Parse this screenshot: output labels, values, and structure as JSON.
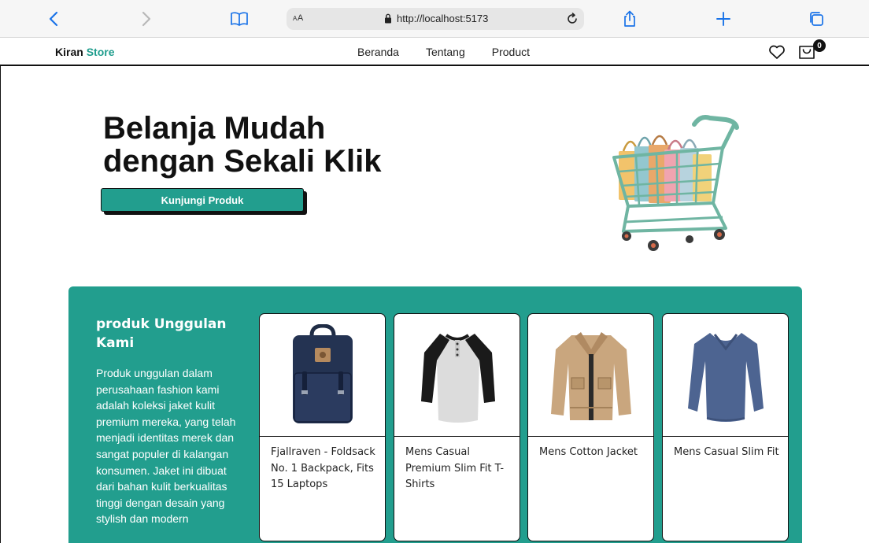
{
  "browser": {
    "text_size_label": "AA",
    "url": "http://localhost:5173"
  },
  "nav": {
    "brand_primary": "Kiran",
    "brand_accent": "Store",
    "links": [
      "Beranda",
      "Tentang",
      "Product"
    ],
    "cart_count": "0"
  },
  "hero": {
    "title_line1": "Belanja Mudah",
    "title_line2": "dengan Sekali Klik",
    "cta_label": "Kunjungi Produk"
  },
  "featured": {
    "title": "produk Unggulan Kami",
    "description": "Produk unggulan dalam perusahaan fashion kami adalah koleksi jaket kulit premium mereka, yang telah menjadi identitas merek dan sangat populer di kalangan konsumen. Jaket ini dibuat dari bahan kulit berkualitas tinggi dengan desain yang stylish dan modern",
    "products": [
      {
        "name": "Fjallraven - Foldsack No. 1 Backpack, Fits 15 Laptops",
        "image": "backpack"
      },
      {
        "name": "Mens Casual Premium Slim Fit T-Shirts",
        "image": "raglan-shirt"
      },
      {
        "name": "Mens Cotton Jacket",
        "image": "jacket"
      },
      {
        "name": "Mens Casual Slim Fit",
        "image": "long-sleeve-shirt"
      }
    ]
  },
  "colors": {
    "accent": "#229e8e",
    "text": "#111111"
  }
}
